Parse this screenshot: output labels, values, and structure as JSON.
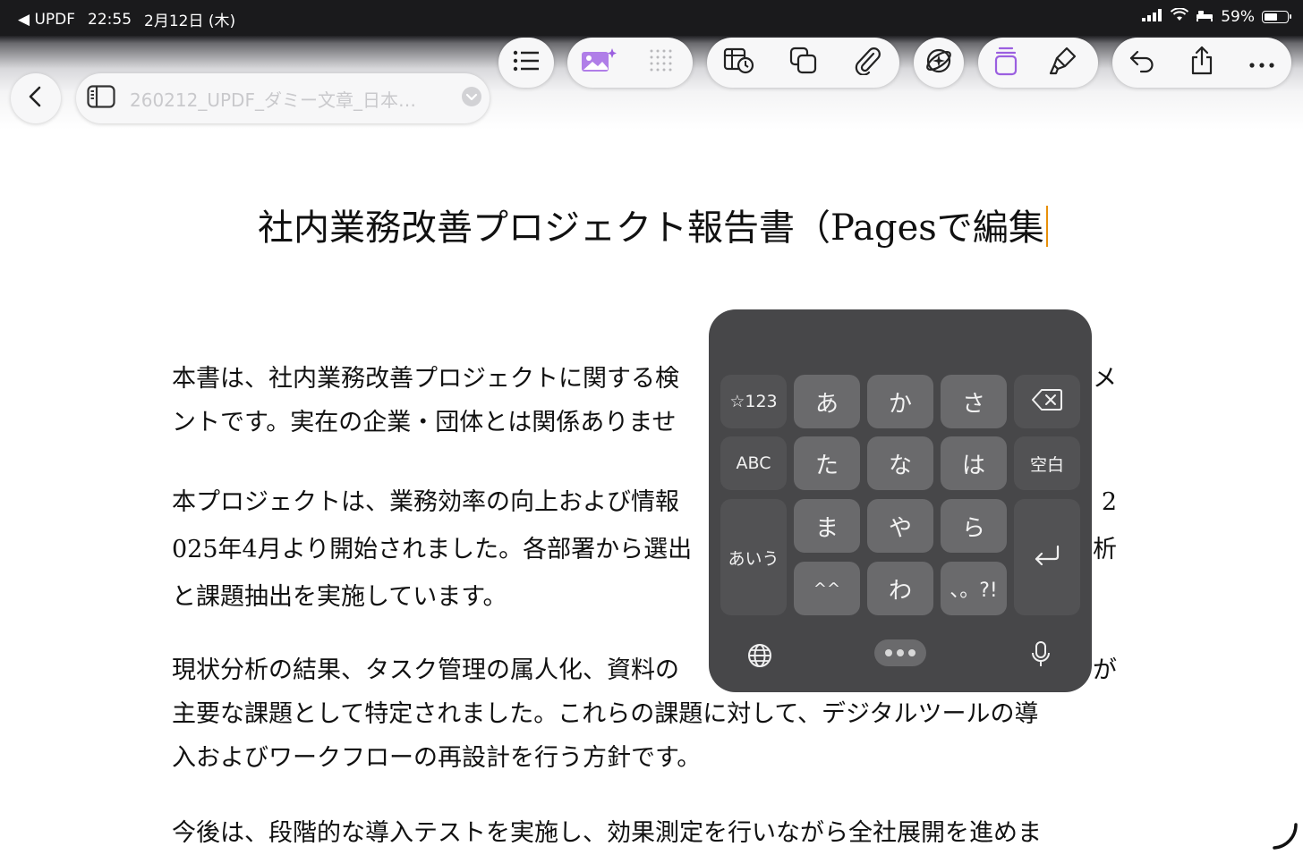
{
  "status_bar": {
    "back_app": "◀ UPDF",
    "time": "22:55",
    "date": "2月12日 (木)",
    "battery": "59%",
    "battery_level": 0.59
  },
  "toolbar": {
    "document_title": "260212_UPDF_ダミー文章_日本…",
    "icons": [
      "back-chevron-icon",
      "sidebar-icon",
      "dropdown-chevron-icon",
      "list-icon",
      "ai-image-icon",
      "grid-dots-icon",
      "table-clock-icon",
      "copy-shapes-icon",
      "paperclip-icon",
      "ai-sparkle-icon",
      "pages-stack-icon",
      "highlighter-icon",
      "undo-icon",
      "share-icon",
      "more-icon"
    ],
    "accent_color": "#9b5fe0"
  },
  "document": {
    "heading": "社内業務改善プロジェクト報告書（Pagesで編集",
    "paragraphs": [
      {
        "lines": [
          {
            "segments": [
              "本書は、社内業務改善プロジェクトに関する検",
              "メ"
            ]
          },
          {
            "segments": [
              "ントです。実在の企業・団体とは関係ありませ"
            ]
          }
        ]
      },
      {
        "lines": [
          {
            "segments": [
              "本プロジェクトは、業務効率の向上および情報",
              "2"
            ]
          },
          {
            "segments": [
              "025年4月より開始されました。各部署から選出",
              "析"
            ]
          },
          {
            "segments": [
              "と課題抽出を実施しています。"
            ]
          }
        ]
      },
      {
        "lines": [
          {
            "segments": [
              "現状分析の結果、タスク管理の属人化、資料の",
              "が"
            ]
          },
          {
            "segments": [
              "主要な課題として特定されました。これらの課題に対して、デジタルツールの導"
            ]
          },
          {
            "segments": [
              "入およびワークフローの再設計を行う方針です。"
            ]
          }
        ]
      },
      {
        "lines": [
          {
            "segments": [
              "今後は、段階的な導入テストを実施し、効果測定を行いながら全社展開を進めま"
            ]
          }
        ]
      }
    ]
  },
  "keyboard": {
    "keys": {
      "symbols": "☆123",
      "a": "あ",
      "ka": "か",
      "sa": "さ",
      "abc": "ABC",
      "ta": "た",
      "na": "な",
      "ha": "は",
      "space": "空白",
      "aiu": "あいう",
      "ma": "ま",
      "ya": "や",
      "ra": "ら",
      "dakuten": "^^",
      "wa": "わ",
      "punct": "、。?!"
    },
    "bottom_icons": [
      "globe-icon",
      "more-dots-icon",
      "microphone-icon"
    ]
  }
}
